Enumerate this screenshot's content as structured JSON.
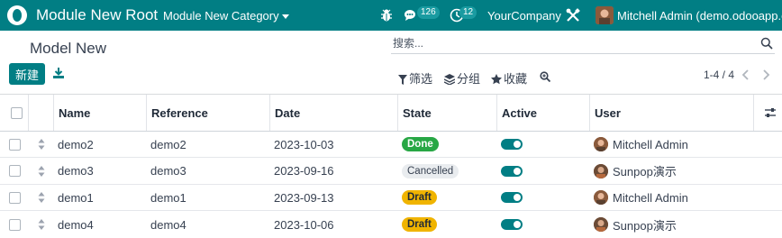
{
  "navbar": {
    "app_name": "Module New Root",
    "menu_category": "Module New Category",
    "chat_count": "126",
    "activity_count": "12",
    "company": "YourCompany",
    "user": "Mitchell Admin (demo.odooapp.cn)",
    "icons": [
      "odoo-logo-icon",
      "bug-icon",
      "chat-icon",
      "clock-icon",
      "tools-icon"
    ]
  },
  "control": {
    "title": "Model New",
    "search_placeholder": "搜索...",
    "new_label": "新建",
    "filters_label": "筛选",
    "group_label": "分组",
    "favorites_label": "收藏",
    "pager_text": "1-4 / 4"
  },
  "table": {
    "headers": {
      "name": "Name",
      "reference": "Reference",
      "date": "Date",
      "state": "State",
      "active": "Active",
      "user": "User"
    },
    "rows": [
      {
        "name": "demo2",
        "reference": "demo2",
        "date": "2023-10-03",
        "state": "Done",
        "state_type": "done",
        "active": true,
        "user": "Mitchell Admin"
      },
      {
        "name": "demo3",
        "reference": "demo3",
        "date": "2023-09-16",
        "state": "Cancelled",
        "state_type": "cancelled",
        "active": true,
        "user": "Sunpop演示"
      },
      {
        "name": "demo1",
        "reference": "demo1",
        "date": "2023-09-13",
        "state": "Draft",
        "state_type": "draft",
        "active": true,
        "user": "Mitchell Admin"
      },
      {
        "name": "demo4",
        "reference": "demo4",
        "date": "2023-10-06",
        "state": "Draft",
        "state_type": "draft",
        "active": true,
        "user": "Sunpop演示"
      }
    ]
  },
  "colors": {
    "brand": "#017e84",
    "done": "#28a745",
    "draft": "#f0b400",
    "cancelled": "#e9ecef"
  }
}
